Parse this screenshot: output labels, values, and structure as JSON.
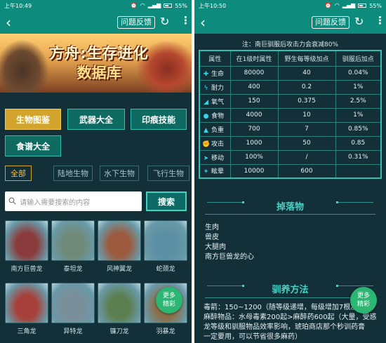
{
  "left": {
    "status": {
      "time": "上午10:49",
      "battery": "55%"
    },
    "header": {
      "feedback_label": "问题反馈"
    },
    "banner": {
      "line1": "方舟:生存进化",
      "line2": "数据库"
    },
    "categories": [
      {
        "label": "生物图鉴",
        "active": true
      },
      {
        "label": "武器大全",
        "active": false
      },
      {
        "label": "印痕技能",
        "active": false
      },
      {
        "label": "食谱大全",
        "active": false
      }
    ],
    "filters": [
      {
        "label": "全部",
        "active": true
      },
      {
        "label": "陆地生物",
        "active": false
      },
      {
        "label": "水下生物",
        "active": false
      },
      {
        "label": "飞行生物",
        "active": false
      }
    ],
    "search": {
      "placeholder": "请输入需要搜索的内容",
      "button_label": "搜索"
    },
    "creatures": [
      {
        "name": "南方巨兽龙",
        "color": "#8a3b3b"
      },
      {
        "name": "泰坦龙",
        "color": "#6f8a78"
      },
      {
        "name": "风神翼龙",
        "color": "#9c5a3e"
      },
      {
        "name": "蛇颈龙",
        "color": "#5b8fa3"
      },
      {
        "name": "三角龙",
        "color": "#a7403a"
      },
      {
        "name": "异特龙",
        "color": "#7a8f9a"
      },
      {
        "name": "镰刀龙",
        "color": "#5c7f52"
      },
      {
        "name": "羽暴龙",
        "color": "#8a6f4a"
      }
    ],
    "more": {
      "line1": "更多",
      "line2": "精彩"
    }
  },
  "right": {
    "status": {
      "time": "上午10:50",
      "battery": "55%"
    },
    "header": {
      "feedback_label": "问题反馈"
    },
    "note": "注：南巨驯服后攻击力会衰减80%",
    "table": {
      "headers": [
        "属性",
        "在1级时属性",
        "野生每等级加点",
        "驯服后加点"
      ],
      "rows": [
        {
          "icon": "health-icon",
          "glyph": "✚",
          "attr": "生命",
          "base": "80000",
          "wild": "40",
          "tamed": "0.04%"
        },
        {
          "icon": "stamina-icon",
          "glyph": "ϟ",
          "attr": "耐力",
          "base": "400",
          "wild": "0.2",
          "tamed": "1%"
        },
        {
          "icon": "oxygen-icon",
          "glyph": "◢",
          "attr": "氧气",
          "base": "150",
          "wild": "0.375",
          "tamed": "2.5%"
        },
        {
          "icon": "food-icon",
          "glyph": "●",
          "attr": "食物",
          "base": "4000",
          "wild": "10",
          "tamed": "1%"
        },
        {
          "icon": "weight-icon",
          "glyph": "▲",
          "attr": "负重",
          "base": "700",
          "wild": "7",
          "tamed": "0.85%"
        },
        {
          "icon": "attack-icon",
          "glyph": "✊",
          "attr": "攻击",
          "base": "1000",
          "wild": "50",
          "tamed": "0.85"
        },
        {
          "icon": "speed-icon",
          "glyph": "➤",
          "attr": "移动",
          "base": "100%",
          "wild": "/",
          "tamed": "0.31%"
        },
        {
          "icon": "torpor-icon",
          "glyph": "✶",
          "attr": "眩晕",
          "base": "10000",
          "wild": "600",
          "tamed": ""
        }
      ]
    },
    "drops_title": "掉落物",
    "drops": [
      "生肉",
      "兽皮",
      "大腿肉",
      "南方巨兽龙的心"
    ],
    "taming_title": "驯养方法",
    "taming_lines": [
      "毒箭：150~1200（随等级递增，每级增加7根左",
      "麻醉物品：水母毒素200起>麻醉药600起（大量，受惑",
      "龙等级和驯服物品效率影响，琥珀商店那个秒训药膏",
      "一定要用，可以节省很多麻药）"
    ],
    "more": {
      "line1": "更多",
      "line2": "精彩"
    }
  }
}
